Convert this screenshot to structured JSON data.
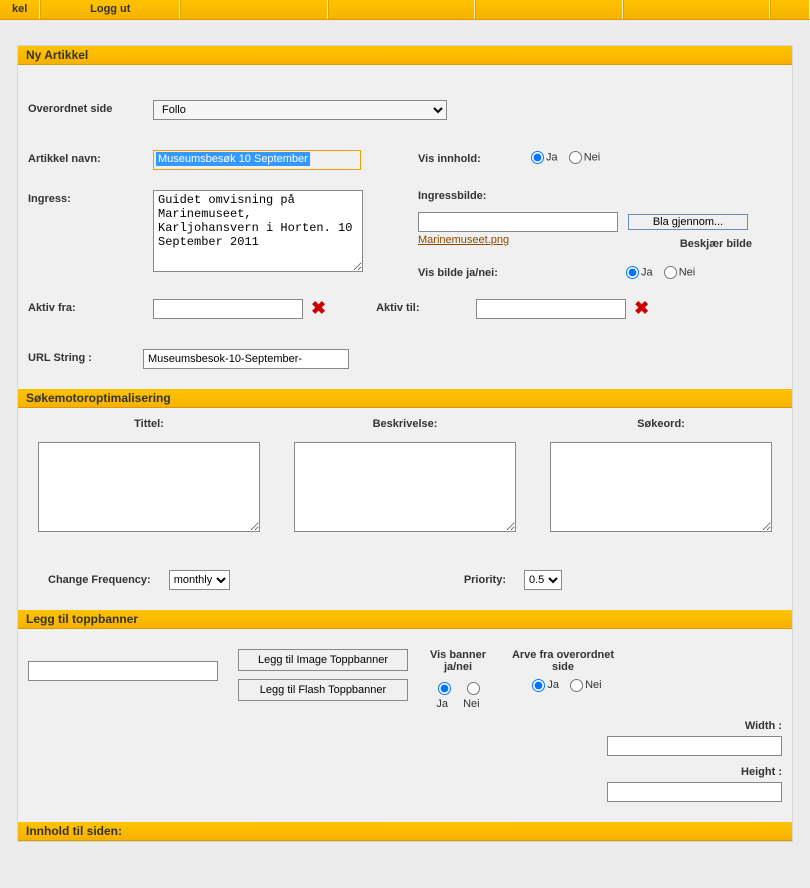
{
  "topbar": {
    "kel": "kel",
    "loggut": "Logg ut"
  },
  "section1": {
    "title": "Ny Artikkel",
    "overordnet_label": "Overordnet side",
    "overordnet_value": "Follo",
    "artikkelnavn_label": "Artikkel navn:",
    "artikkelnavn_value": "Museumsbesøk 10 September",
    "visinnhold_label": "Vis innhold:",
    "ja": "Ja",
    "nei": "Nei",
    "ingress_label": "Ingress:",
    "ingress_value": "Guidet omvisning på Marinemuseet, Karljohansvern i Horten. 10 September 2011",
    "ingressbilde_label": "Ingressbilde:",
    "ingressbilde_value": "",
    "bla_gjennom": "Bla gjennom...",
    "ingressbilde_file": "Marinemuseet.png",
    "beskjaer": "Beskjær bilde",
    "visbilde_label": "Vis bilde ja/nei:",
    "aktivfra_label": "Aktiv fra:",
    "aktivfra_value": "",
    "aktivtil_label": "Aktiv til:",
    "aktivtil_value": "",
    "urlstring_label": "URL String :",
    "urlstring_value": "Museumsbesok-10-September-"
  },
  "seo": {
    "title": "Søkemotoroptimalisering",
    "tittel_label": "Tittel:",
    "tittel_value": "",
    "beskrivelse_label": "Beskrivelse:",
    "beskrivelse_value": "",
    "sokeord_label": "Søkeord:",
    "sokeord_value": "",
    "change_freq_label": "Change Frequency:",
    "change_freq_value": "monthly",
    "priority_label": "Priority:",
    "priority_value": "0.5"
  },
  "banner": {
    "title": "Legg til toppbanner",
    "input_value": "",
    "btn_image": "Legg til Image Toppbanner",
    "btn_flash": "Legg til Flash Toppbanner",
    "visbanner_label": "Vis banner ja/nei",
    "arvefra_label": "Arve fra overordnet side",
    "ja": "Ja",
    "nei": "Nei",
    "width_label": "Width :",
    "width_value": "",
    "height_label": "Height :",
    "height_value": ""
  },
  "innhold": {
    "title": "Innhold til siden:"
  }
}
